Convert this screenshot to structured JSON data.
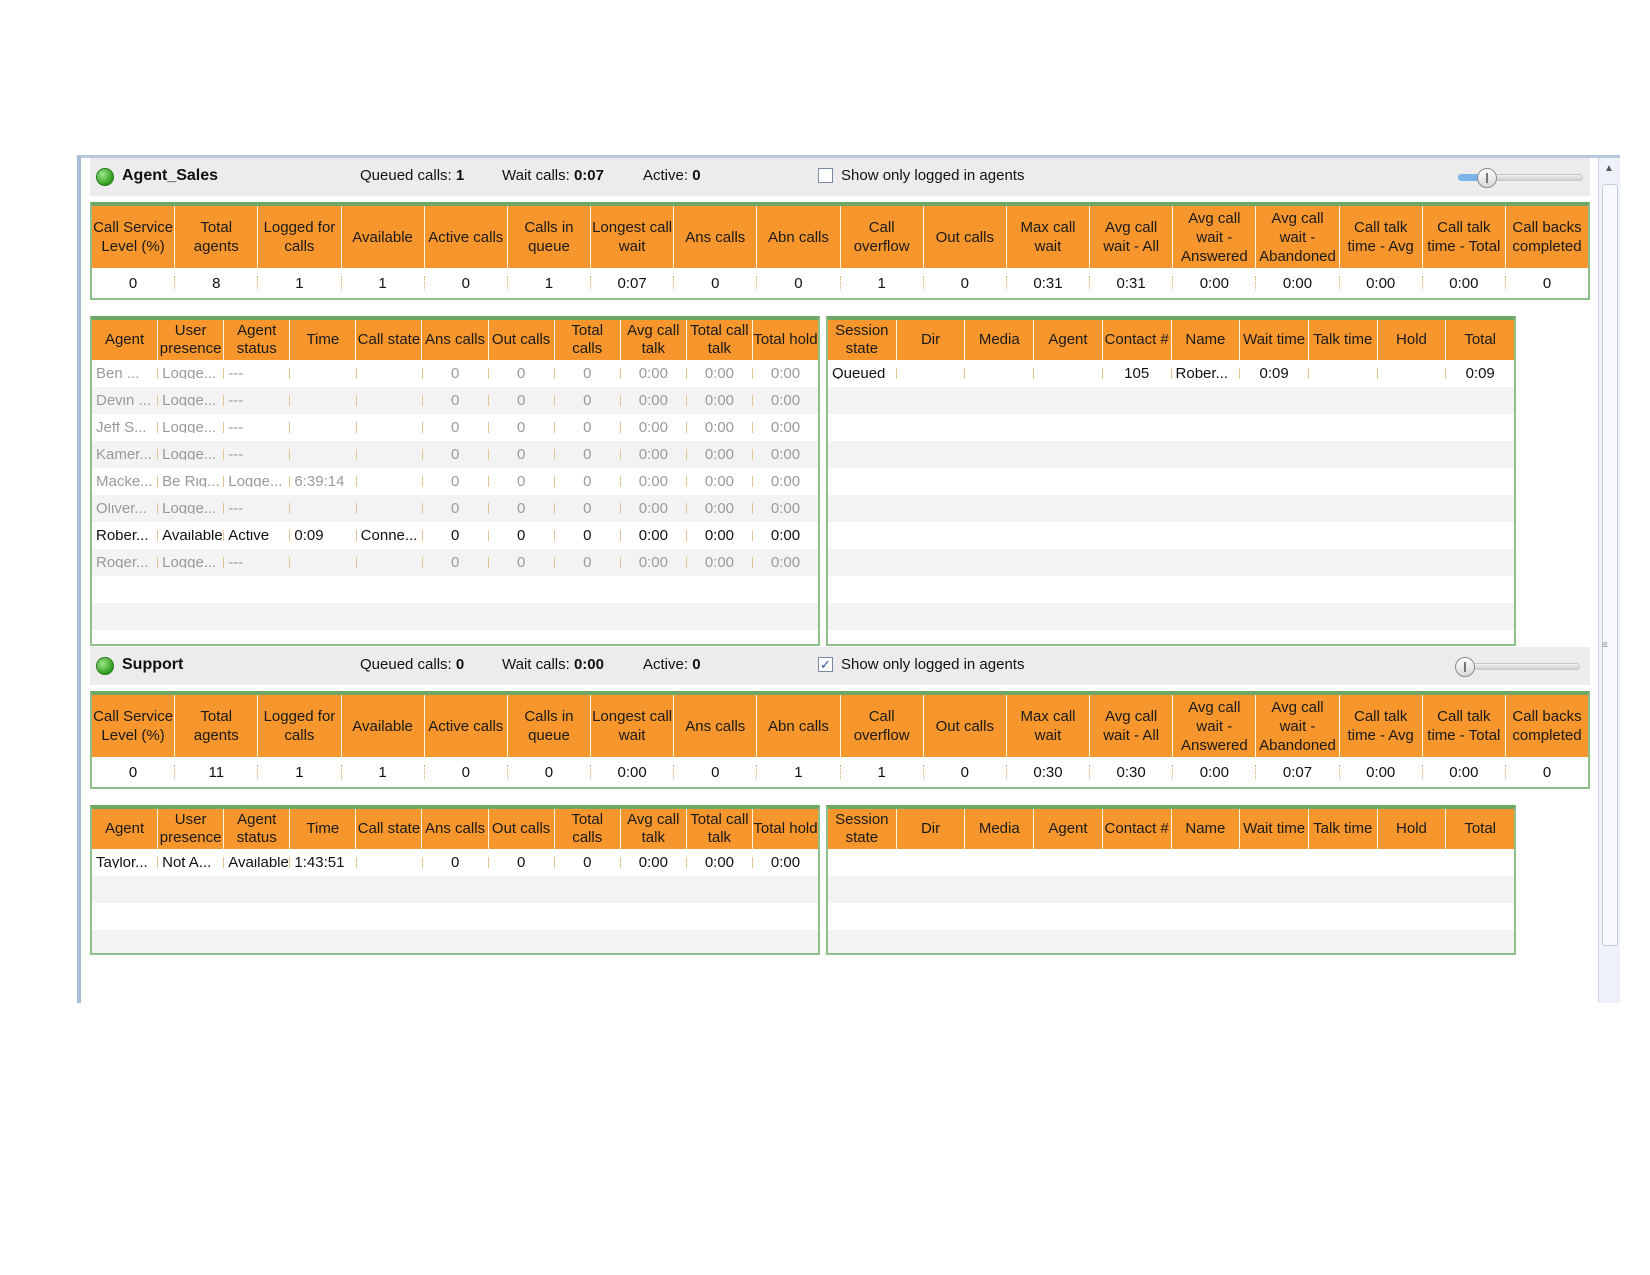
{
  "agent_columns": [
    "Agent",
    "User presence",
    "Agent status",
    "Time",
    "Call state",
    "Ans calls",
    "Out calls",
    "Total calls",
    "Avg call talk",
    "Total call talk",
    "Total hold"
  ],
  "session_columns": [
    "Session state",
    "Dir",
    "Media",
    "Agent",
    "Contact #",
    "Name",
    "Wait time",
    "Talk time",
    "Hold",
    "Total"
  ],
  "stat_columns": [
    "Call Service Level (%)",
    "Total agents",
    "Logged for calls",
    "Available",
    "Active calls",
    "Calls in queue",
    "Longest call wait",
    "Ans calls",
    "Abn calls",
    "Call overflow",
    "Out calls",
    "Max call wait",
    "Avg call wait - All",
    "Avg call wait - Answered",
    "Avg call wait - Abandoned",
    "Call talk time - Avg",
    "Call talk time - Total",
    "Call backs completed"
  ],
  "queues": [
    {
      "name": "Agent_Sales",
      "queued_label": "Queued calls:",
      "queued_value": "1",
      "wait_label": "Wait calls:",
      "wait_value": "0:07",
      "active_label": "Active:",
      "active_value": "0",
      "show_logged_label": "Show only logged in agents",
      "show_logged_checked": false,
      "slider_level": 0.15,
      "stats": [
        "0",
        "8",
        "1",
        "1",
        "0",
        "1",
        "0:07",
        "0",
        "0",
        "1",
        "0",
        "0:31",
        "0:31",
        "0:00",
        "0:00",
        "0:00",
        "0:00",
        "0"
      ],
      "agents": [
        {
          "dim": true,
          "cells": [
            "Ben ...",
            "Logge...",
            "---",
            "",
            "",
            "0",
            "0",
            "0",
            "0:00",
            "0:00",
            "0:00"
          ]
        },
        {
          "dim": true,
          "cells": [
            "Devin ...",
            "Logge...",
            "---",
            "",
            "",
            "0",
            "0",
            "0",
            "0:00",
            "0:00",
            "0:00"
          ]
        },
        {
          "dim": true,
          "cells": [
            "Jeff S...",
            "Logge...",
            "---",
            "",
            "",
            "0",
            "0",
            "0",
            "0:00",
            "0:00",
            "0:00"
          ]
        },
        {
          "dim": true,
          "cells": [
            "Kamer...",
            "Logge...",
            "---",
            "",
            "",
            "0",
            "0",
            "0",
            "0:00",
            "0:00",
            "0:00"
          ]
        },
        {
          "dim": true,
          "cells": [
            "Macke...",
            "Be Rig...",
            "Logge...",
            "6:39:14",
            "",
            "0",
            "0",
            "0",
            "0:00",
            "0:00",
            "0:00"
          ]
        },
        {
          "dim": true,
          "cells": [
            "Oliver...",
            "Logge...",
            "---",
            "",
            "",
            "0",
            "0",
            "0",
            "0:00",
            "0:00",
            "0:00"
          ]
        },
        {
          "dim": false,
          "cells": [
            "Rober...",
            "Available",
            "Active",
            "0:09",
            "Conne...",
            "0",
            "0",
            "0",
            "0:00",
            "0:00",
            "0:00"
          ]
        },
        {
          "dim": true,
          "cells": [
            "Roger...",
            "Logge...",
            "---",
            "",
            "",
            "0",
            "0",
            "0",
            "0:00",
            "0:00",
            "0:00"
          ]
        }
      ],
      "sessions": [
        {
          "cells": [
            "Queued",
            "",
            "",
            "",
            "105",
            "Rober...",
            "0:09",
            "",
            "",
            "0:09"
          ]
        }
      ]
    },
    {
      "name": "Support",
      "queued_label": "Queued calls:",
      "queued_value": "0",
      "wait_label": "Wait calls:",
      "wait_value": "0:00",
      "active_label": "Active:",
      "active_value": "0",
      "show_logged_label": "Show only logged in agents",
      "show_logged_checked": true,
      "slider_level": 0.0,
      "stats": [
        "0",
        "11",
        "1",
        "1",
        "0",
        "0",
        "0:00",
        "0",
        "1",
        "1",
        "0",
        "0:30",
        "0:30",
        "0:00",
        "0:07",
        "0:00",
        "0:00",
        "0"
      ],
      "agents": [
        {
          "dim": false,
          "cells": [
            "Taylor...",
            "Not A...",
            "Available",
            "1:43:51",
            "",
            "0",
            "0",
            "0",
            "0:00",
            "0:00",
            "0:00"
          ]
        }
      ],
      "sessions": []
    }
  ]
}
